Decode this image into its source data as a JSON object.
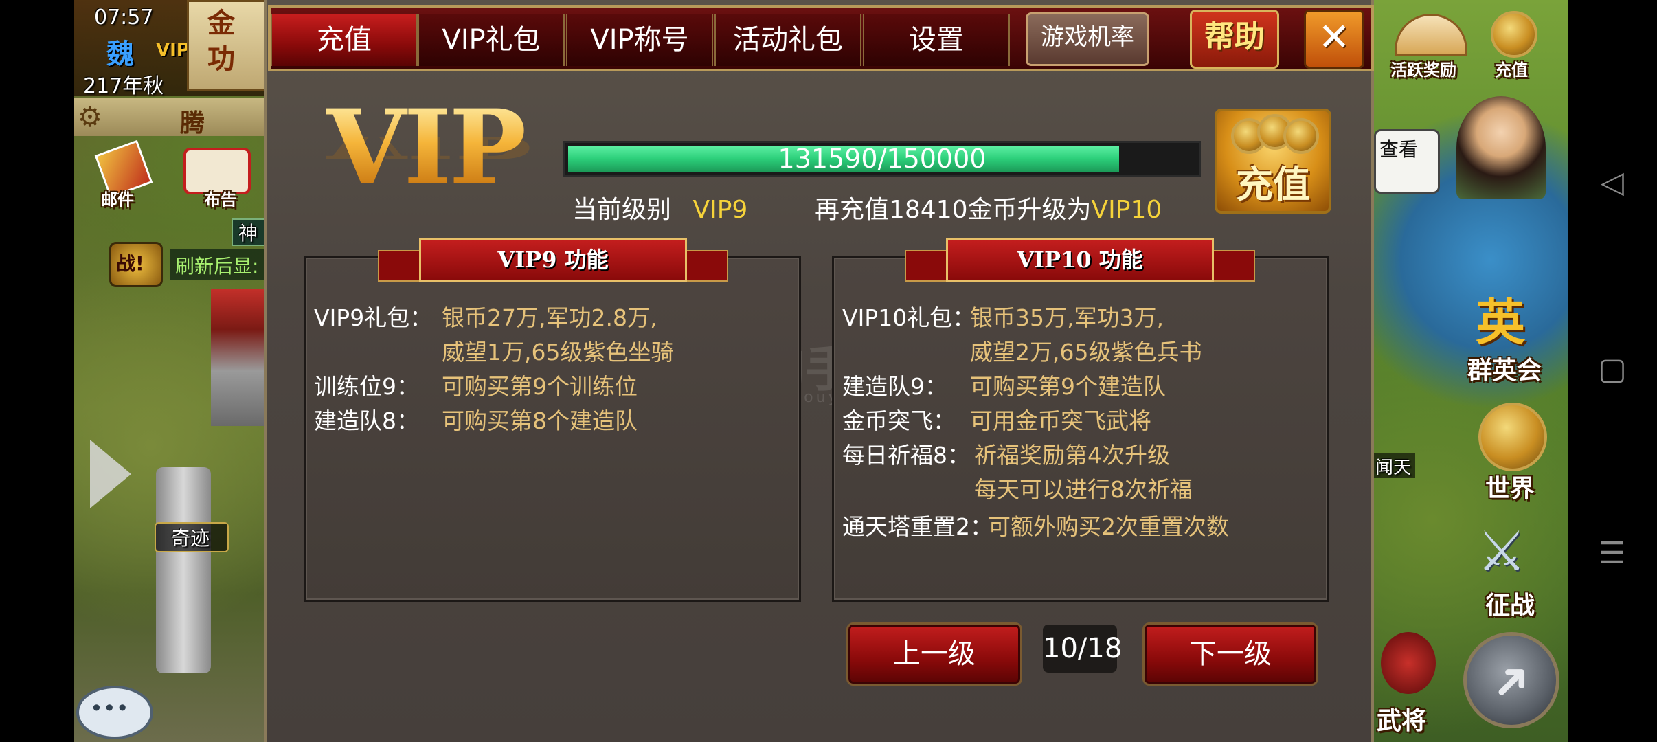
{
  "status": {
    "time": "07:57"
  },
  "hud": {
    "kingdom": "魏",
    "vip_badge": "VIP",
    "season": "217年秋",
    "resource_label": "金 功",
    "banner_text": "腾",
    "mail_label": "邮件",
    "notice_label": "布告",
    "refresh_text": "刷新后显:",
    "shen_text": "神",
    "battle_icon_label": "战!",
    "miracle_label": "奇迹",
    "right_menu": {
      "activity_reward": "活跃奖励",
      "recharge": "充值",
      "view_text": "查看",
      "heroes": "群英会",
      "world": "世界",
      "expedition": "征战",
      "generals": "武将",
      "tian_text": "闻天"
    }
  },
  "modal": {
    "tabs": [
      {
        "label": "充值"
      },
      {
        "label": "VIP礼包"
      },
      {
        "label": "VIP称号"
      },
      {
        "label": "活动礼包"
      },
      {
        "label": "设置"
      }
    ],
    "game_odds_button": "游戏机率",
    "help_button": "帮助",
    "close_symbol": "✕",
    "vip_logo": "VIP",
    "progress": {
      "current": 131590,
      "max": 150000,
      "fraction": 0.8773,
      "text": "131590/150000"
    },
    "current_level_label": "当前级别",
    "current_level_value": "VIP9",
    "upgrade_prefix": "再充值18410金币升级为",
    "upgrade_target": "VIP10",
    "recharge_button": "充值",
    "left_panel": {
      "title": "VIP9 功能",
      "rows": [
        {
          "label": "VIP9礼包：",
          "lines": [
            "银币27万,军功2.8万,",
            "威望1万,65级紫色坐骑"
          ]
        },
        {
          "label": "训练位9：",
          "lines": [
            "可购买第9个训练位"
          ]
        },
        {
          "label": "建造队8：",
          "lines": [
            "可购买第8个建造队"
          ]
        }
      ]
    },
    "right_panel": {
      "title": "VIP10 功能",
      "rows": [
        {
          "label": "VIP10礼包：",
          "lines": [
            "银币35万,军功3万,",
            "威望2万,65级紫色兵书"
          ]
        },
        {
          "label": "建造队9：",
          "lines": [
            "可购买第9个建造队"
          ]
        },
        {
          "label": "金币突飞：",
          "lines": [
            "可用金币突飞武将"
          ]
        },
        {
          "label": "每日祈福8：",
          "lines": [
            "祈福奖励第4次升级",
            "每天可以进行8次祈福"
          ]
        },
        {
          "label": "通天塔重置2：",
          "lines": [
            "可额外购买2次重置次数"
          ]
        }
      ]
    },
    "prev_button": "上一级",
    "next_button": "下一级",
    "page_indicator": "10/18",
    "watermark": "淘手游",
    "watermark_sub": "Taoshouyou.com"
  }
}
